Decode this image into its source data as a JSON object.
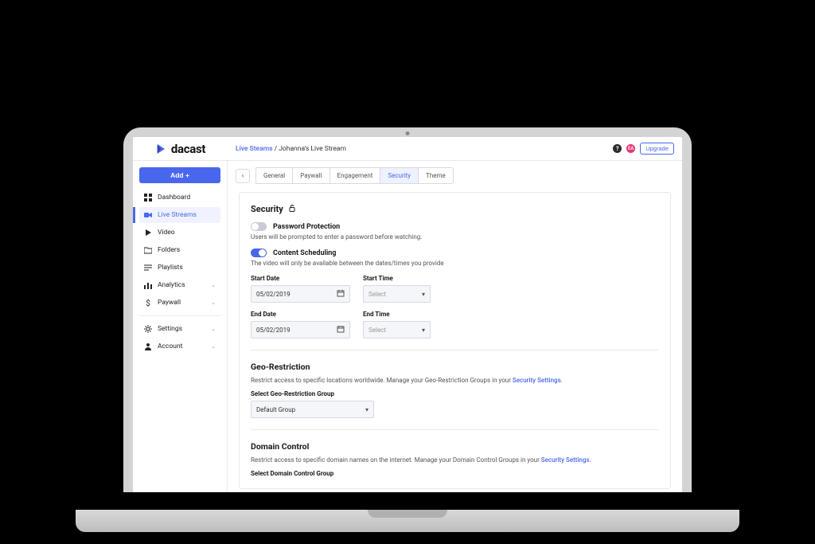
{
  "brand": "dacast",
  "breadcrumb": {
    "root": "Live Steams",
    "sep": " / ",
    "current": "Johanna's Live Stream"
  },
  "header": {
    "help": "?",
    "avatar_initials": "EA",
    "upgrade": "Upgrade"
  },
  "sidebar": {
    "add_label": "Add +",
    "items": [
      {
        "label": "Dashboard"
      },
      {
        "label": "Live Streams"
      },
      {
        "label": "Video"
      },
      {
        "label": "Folders"
      },
      {
        "label": "Playlists"
      },
      {
        "label": "Analytics"
      },
      {
        "label": "Paywall"
      }
    ],
    "items2": [
      {
        "label": "Settings"
      },
      {
        "label": "Account"
      }
    ]
  },
  "tabs": {
    "back": "‹",
    "items": [
      "General",
      "Paywall",
      "Engagement",
      "Security",
      "Theme"
    ],
    "active": "Security"
  },
  "security": {
    "title": "Security",
    "password": {
      "label": "Password Protection",
      "desc": "Users will be prompted to enter a password before watching."
    },
    "scheduling": {
      "label": "Content Scheduling",
      "desc": "The video will only be available between the dates/times you provide"
    },
    "fields": {
      "start_date_label": "Start Date",
      "start_date_value": "05/02/2019",
      "start_time_label": "Start Time",
      "start_time_placeholder": "Select",
      "end_date_label": "End Date",
      "end_date_value": "05/02/2019",
      "end_time_label": "End Time",
      "end_time_placeholder": "Select"
    },
    "geo": {
      "title": "Geo-Restriction",
      "desc_prefix": "Restrict access to specific locations worldwide. Manage your Geo-Restriction Groups in your ",
      "desc_link": "Security Settings",
      "desc_suffix": ".",
      "select_label": "Select Geo-Restriction Group",
      "select_value": "Default Group"
    },
    "domain": {
      "title": "Domain Control",
      "desc_prefix": "Restrict access to specific domain names on the internet. Manage your Domain Control Groups in your ",
      "desc_link": "Security Settings",
      "desc_suffix": ".",
      "select_label": "Select Domain Control Group"
    }
  }
}
